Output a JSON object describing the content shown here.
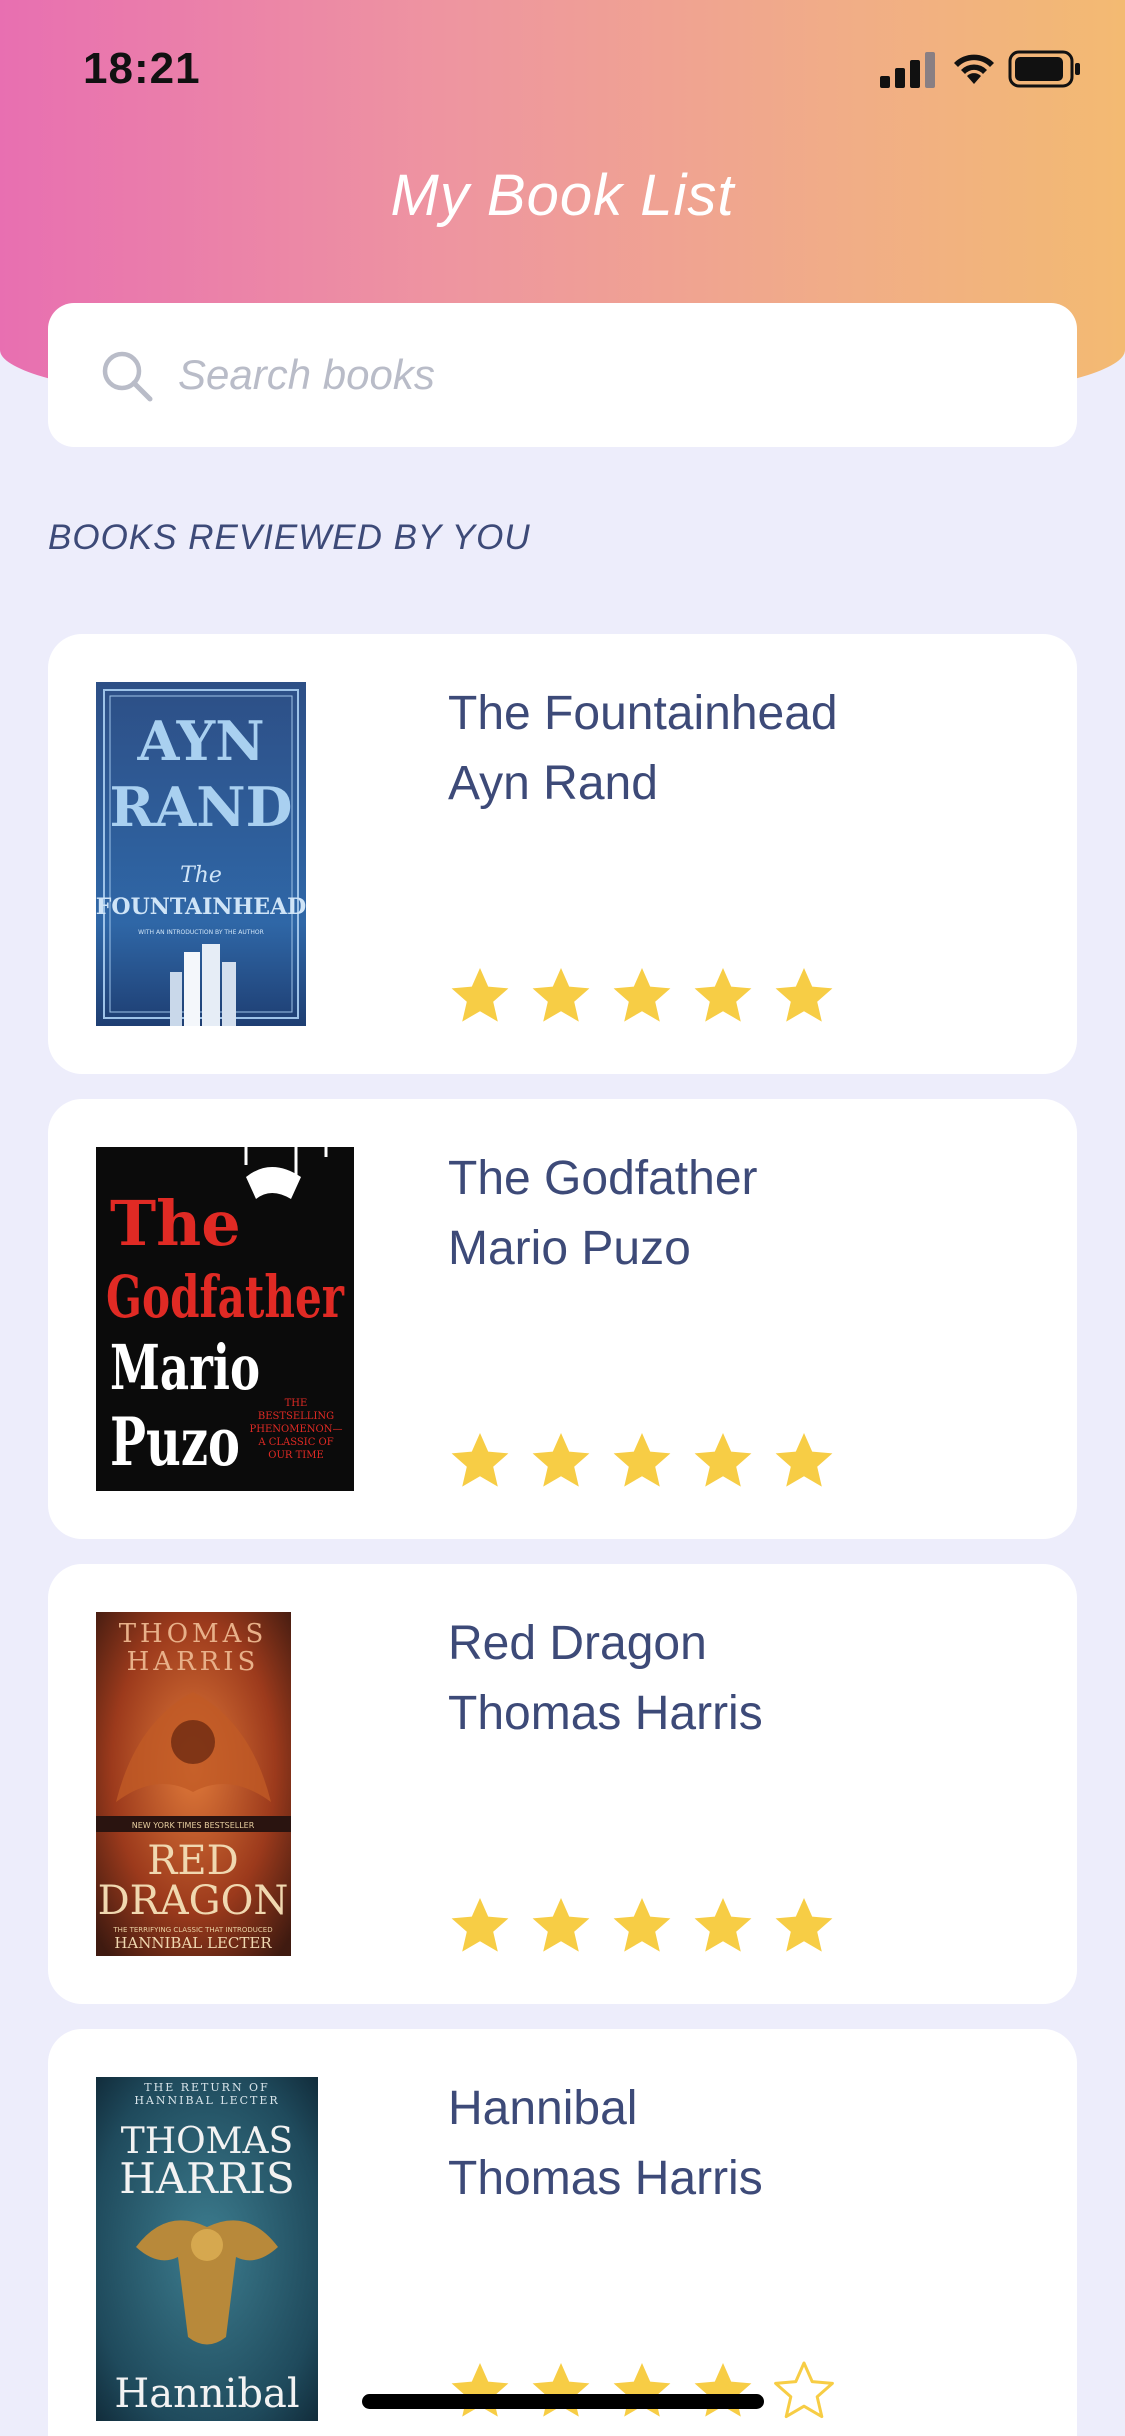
{
  "status_bar": {
    "time": "18:21"
  },
  "header": {
    "title": "My Book List"
  },
  "search": {
    "placeholder": "Search books",
    "value": ""
  },
  "section": {
    "label": "BOOKS REVIEWED BY YOU"
  },
  "books": [
    {
      "title": "The Fountainhead",
      "author": "Ayn Rand",
      "rating": 5,
      "cover": {
        "line1": "AYN",
        "line2": "RAND",
        "line3": "The",
        "line4": "FOUNTAINHEAD",
        "line5": "WITH AN INTRODUCTION BY THE AUTHOR"
      }
    },
    {
      "title": "The Godfather",
      "author": "Mario Puzo",
      "rating": 5,
      "cover": {
        "line1": "The",
        "line2": "Godfather",
        "line3": "Mario",
        "line4": "Puzo",
        "line5": "THE BESTSELLING PHENOMENON— A CLASSIC OF OUR TIME"
      }
    },
    {
      "title": "Red Dragon",
      "author": "Thomas Harris",
      "rating": 5,
      "cover": {
        "line1": "THOMAS",
        "line2": "HARRIS",
        "line3": "NEW YORK TIMES BESTSELLER",
        "line4": "RED",
        "line5": "DRAGON",
        "line6": "THE TERRIFYING CLASSIC THAT INTRODUCED",
        "line7": "HANNIBAL LECTER"
      }
    },
    {
      "title": "Hannibal",
      "author": "Thomas Harris",
      "rating": 4,
      "cover": {
        "line1": "THE RETURN OF HANNIBAL LECTER",
        "line2": "THOMAS",
        "line3": "HARRIS",
        "line4": "Hannibal"
      }
    }
  ],
  "colors": {
    "gradient_start": "#e86fb1",
    "gradient_end": "#f3ba72",
    "background": "#ededfb",
    "text": "#3d4a78",
    "star": "#f7cd45"
  }
}
